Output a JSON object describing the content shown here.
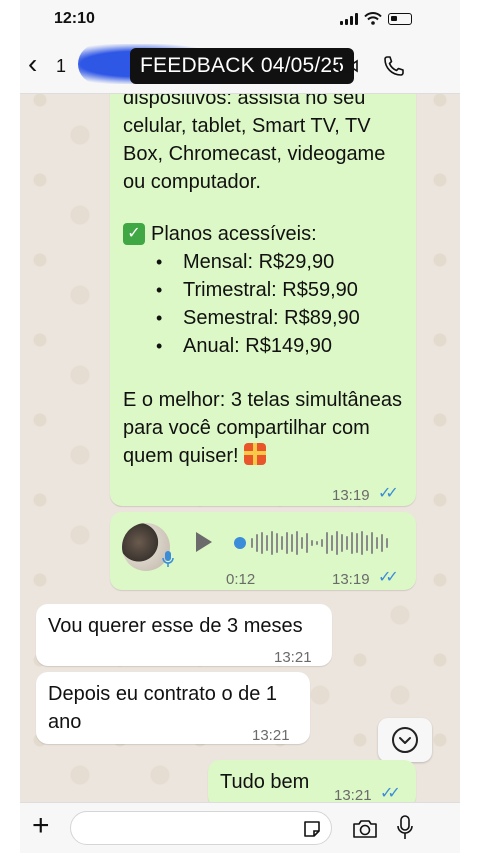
{
  "status_bar": {
    "time": "12:10"
  },
  "header": {
    "unread_count": "1",
    "overlay_tag": "FEEDBACK 04/05/25"
  },
  "messages": {
    "offer": {
      "text_top": "dispositivos: assista no seu\ncelular, tablet, Smart TV, TV\nBox, Chromecast, videogame\nou computador.",
      "plans_title": "Planos acessíveis:",
      "plans": [
        "Mensal: R$29,90",
        "Trimestral: R$59,90",
        "Semestral: R$89,90",
        "Anual: R$149,90"
      ],
      "closing": "E o melhor: 3 telas simultâneas para você compartilhar com quem quiser!",
      "time": "13:19"
    },
    "audio": {
      "duration": "0:12",
      "time": "13:19"
    },
    "incoming_1": {
      "text": "Vou querer esse de 3 meses",
      "time": "13:21"
    },
    "incoming_2": {
      "text": "Depois eu contrato o de 1 ano",
      "time": "13:21"
    },
    "outgoing_3": {
      "text": "Tudo bem",
      "time": "13:21"
    }
  },
  "colors": {
    "outgoing_bubble": "#dcf8c6",
    "incoming_bubble": "#ffffff",
    "read_ticks": "#3b8dd9",
    "chat_background": "#ece5dd"
  },
  "icons": [
    "back-chevron-icon",
    "video-call-icon",
    "phone-icon",
    "play-icon",
    "mic-icon",
    "scroll-down-icon",
    "plus-icon",
    "sticker-icon",
    "camera-icon"
  ]
}
